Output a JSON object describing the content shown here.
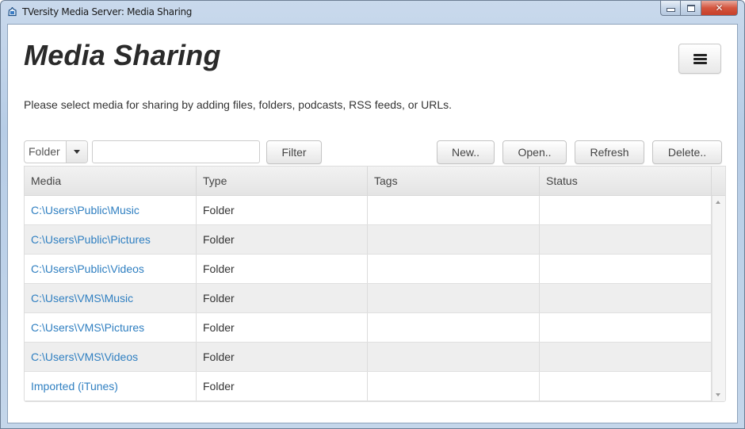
{
  "window": {
    "title": "TVersity Media Server: Media Sharing",
    "controls": {
      "minimize": "minimize",
      "maximize": "maximize",
      "close": "✕"
    }
  },
  "header": {
    "title": "Media Sharing",
    "menu_icon": "hamburger-menu-icon",
    "subtitle": "Please select media for sharing by adding files, folders, podcasts, RSS feeds, or URLs."
  },
  "toolbar": {
    "type_select": {
      "value": "Folder"
    },
    "filter_input": {
      "value": "",
      "placeholder": ""
    },
    "filter_label": "Filter",
    "new_label": "New..",
    "open_label": "Open..",
    "refresh_label": "Refresh",
    "delete_label": "Delete.."
  },
  "table": {
    "columns": [
      "Media",
      "Type",
      "Tags",
      "Status"
    ],
    "rows": [
      {
        "media": "C:\\Users\\Public\\Music",
        "type": "Folder",
        "tags": "",
        "status": ""
      },
      {
        "media": "C:\\Users\\Public\\Pictures",
        "type": "Folder",
        "tags": "",
        "status": ""
      },
      {
        "media": "C:\\Users\\Public\\Videos",
        "type": "Folder",
        "tags": "",
        "status": ""
      },
      {
        "media": "C:\\Users\\VMS\\Music",
        "type": "Folder",
        "tags": "",
        "status": ""
      },
      {
        "media": "C:\\Users\\VMS\\Pictures",
        "type": "Folder",
        "tags": "",
        "status": ""
      },
      {
        "media": "C:\\Users\\VMS\\Videos",
        "type": "Folder",
        "tags": "",
        "status": ""
      },
      {
        "media": "Imported (iTunes)",
        "type": "Folder",
        "tags": "",
        "status": ""
      }
    ]
  },
  "colors": {
    "link": "#2f7fc1",
    "title_text": "#2a2a2a",
    "row_alt": "#eeeeee",
    "close_button": "#c7402b"
  }
}
